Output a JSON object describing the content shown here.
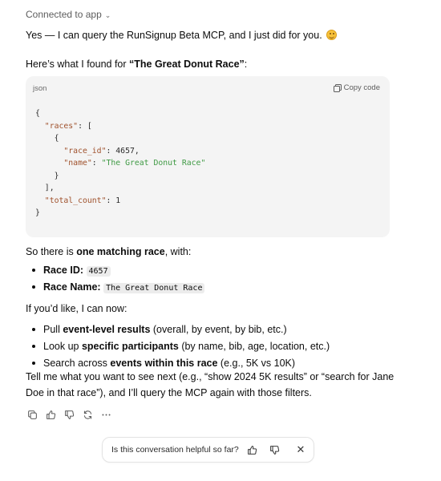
{
  "header": {
    "connected_label": "Connected to app"
  },
  "message": {
    "intro": "Yes — I can query the RunSignup Beta MCP, and I just did for you.",
    "found_prefix": "Here’s what I found for ",
    "found_race": "“The Great Donut Race”",
    "found_suffix": ":",
    "code_block": {
      "language": "json",
      "copy_label": "Copy code",
      "lines": {
        "l1": "{",
        "l2_key": "\"races\"",
        "l2_rest": ": [",
        "l3": "    {",
        "l4_key": "\"race_id\"",
        "l4_sep": ": ",
        "l4_val": "4657",
        "l4_end": ",",
        "l5_key": "\"name\"",
        "l5_sep": ": ",
        "l5_val": "\"The Great Donut Race\"",
        "l6": "    }",
        "l7": "  ],",
        "l8_key": "\"total_count\"",
        "l8_sep": ": ",
        "l8_val": "1",
        "l9": "}"
      }
    },
    "summary_prefix": "So there is ",
    "summary_bold": "one matching race",
    "summary_suffix": ", with:",
    "details": [
      {
        "label": "Race ID:",
        "value": "4657"
      },
      {
        "label": "Race Name:",
        "value": "The Great Donut Race"
      }
    ],
    "offer": "If you’d like, I can now:",
    "options": [
      {
        "pre": "Pull ",
        "bold": "event-level results",
        "post": " (overall, by event, by bib, etc.)"
      },
      {
        "pre": "Look up ",
        "bold": "specific participants",
        "post": " (by name, bib, age, location, etc.)"
      },
      {
        "pre": "Search across ",
        "bold": "events within this race",
        "post": " (e.g., 5K vs 10K)"
      }
    ],
    "closing": "Tell me what you want to see next (e.g., “show 2024 5K results” or “search for Jane Doe in that race”), and I’ll query the MCP again with those filters."
  },
  "actions": [
    "copy-icon",
    "thumbs-up-icon",
    "thumbs-down-icon",
    "regenerate-icon",
    "more-icon"
  ],
  "feedback": {
    "question": "Is this conversation helpful so far?"
  },
  "colors": {
    "code_key": "#a0522d",
    "code_string": "#3f9a44",
    "code_bg": "#f4f4f4"
  }
}
